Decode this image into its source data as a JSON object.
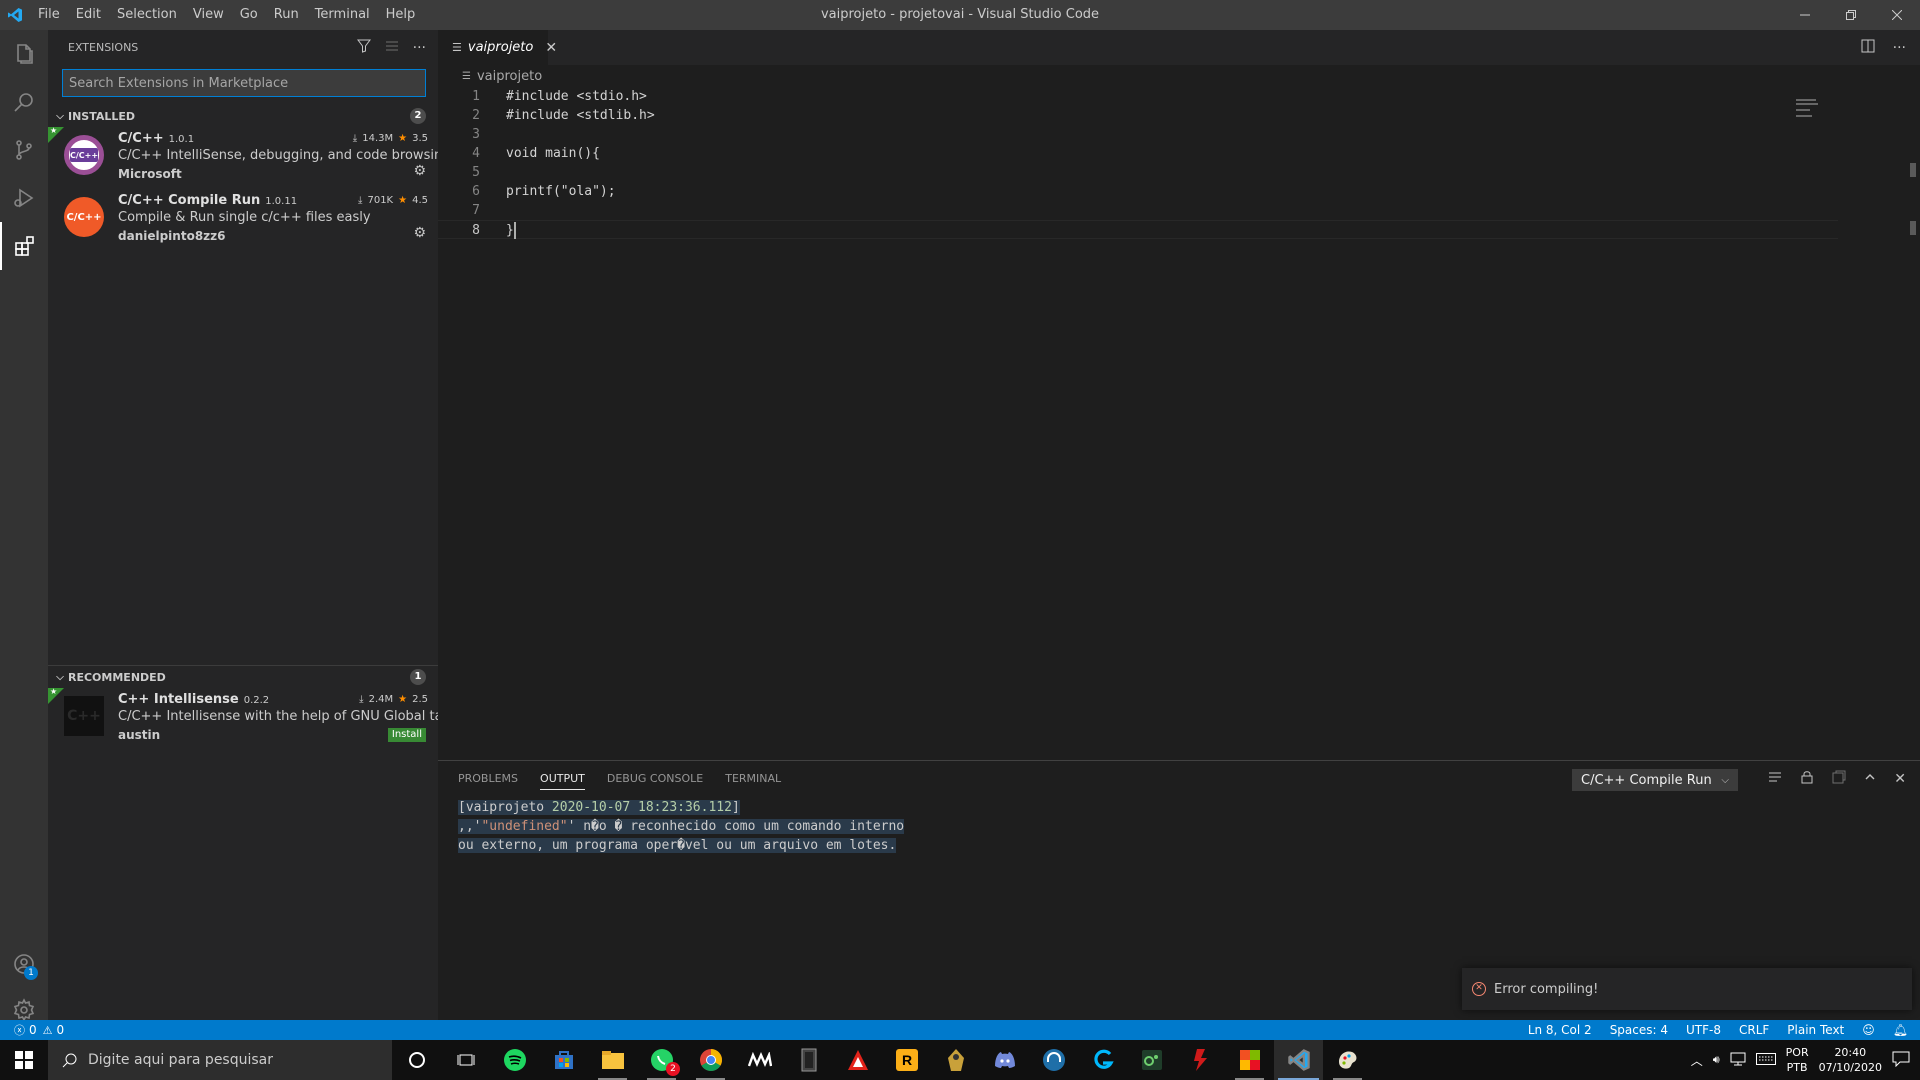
{
  "window": {
    "title": "vaiprojeto - projetovai - Visual Studio Code",
    "menu": [
      "File",
      "Edit",
      "Selection",
      "View",
      "Go",
      "Run",
      "Terminal",
      "Help"
    ]
  },
  "sidebar": {
    "title": "EXTENSIONS",
    "search_placeholder": "Search Extensions in Marketplace",
    "installed": {
      "label": "INSTALLED",
      "count": "2",
      "items": [
        {
          "name": "C/C++",
          "version": "1.0.1",
          "description": "C/C++ IntelliSense, debugging, and code browsing.",
          "publisher": "Microsoft",
          "downloads": "14.3M",
          "rating": "3.5",
          "icon_text": "C/C++"
        },
        {
          "name": "C/C++ Compile Run",
          "version": "1.0.11",
          "description": "Compile & Run single c/c++ files easly",
          "publisher": "danielpinto8zz6",
          "downloads": "701K",
          "rating": "4.5",
          "icon_text": "C/C++"
        }
      ]
    },
    "recommended": {
      "label": "RECOMMENDED",
      "count": "1",
      "items": [
        {
          "name": "C++ Intellisense",
          "version": "0.2.2",
          "description": "C/C++ Intellisense with the help of GNU Global tags",
          "publisher": "austin",
          "downloads": "2.4M",
          "rating": "2.5",
          "install_label": "Install",
          "icon_text": "C++"
        }
      ]
    }
  },
  "editor": {
    "tab_label": "vaiprojeto",
    "breadcrumb": "vaiprojeto",
    "lines": [
      {
        "n": "1",
        "text": "#include <stdio.h>"
      },
      {
        "n": "2",
        "text": "#include <stdlib.h>"
      },
      {
        "n": "3",
        "text": ""
      },
      {
        "n": "4",
        "text": "void main(){"
      },
      {
        "n": "5",
        "text": ""
      },
      {
        "n": "6",
        "text": "printf(\"ola\");"
      },
      {
        "n": "7",
        "text": ""
      },
      {
        "n": "8",
        "text": "}"
      }
    ]
  },
  "panel": {
    "tabs": [
      "PROBLEMS",
      "OUTPUT",
      "DEBUG CONSOLE",
      "TERMINAL"
    ],
    "active_tab": "OUTPUT",
    "output_channel": "C/C++ Compile Run",
    "output_prefix": "[vaiprojeto ",
    "output_timestamp": "2020-10-07 18:23:36.112",
    "output_suffix": "]",
    "output_line2_a": ",,'",
    "output_line2_str": "\"undefined\"",
    "output_line2_b": "' n�o � reconhecido como um comando interno",
    "output_line3": "ou externo, um programa oper�vel ou um arquivo em lotes."
  },
  "notification": {
    "message": "Error compiling!"
  },
  "statusbar": {
    "errors": "0",
    "warnings": "0",
    "position": "Ln 8, Col 2",
    "spaces": "Spaces: 4",
    "encoding": "UTF-8",
    "eol": "CRLF",
    "language": "Plain Text"
  },
  "taskbar": {
    "search_placeholder": "Digite aqui para pesquisar",
    "whatsapp_badge": "2",
    "lang_top": "POR",
    "lang_bottom": "PTB",
    "time": "20:40",
    "date": "07/10/2020"
  },
  "accounts_badge": "1",
  "colors": {
    "accent": "#007acc",
    "error": "#f48771",
    "rating_star": "#ff8e00",
    "install": "#388a34"
  }
}
